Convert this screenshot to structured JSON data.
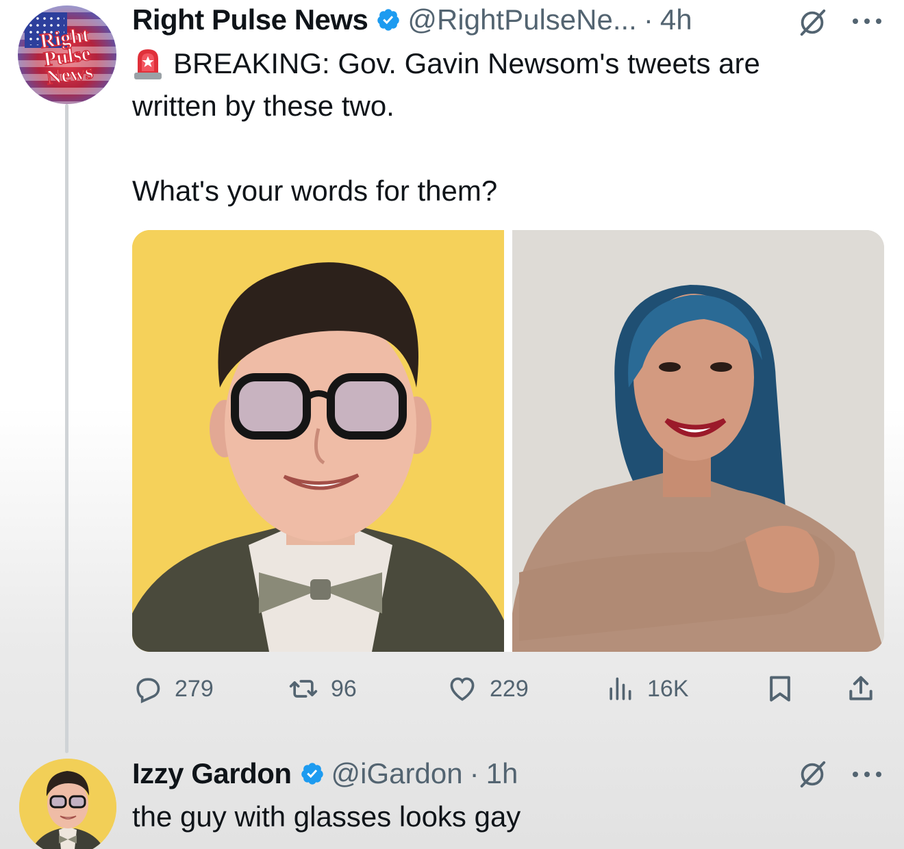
{
  "tweet": {
    "display_name": "Right Pulse News",
    "handle": "@RightPulseNe...",
    "separator": "·",
    "time": "4h",
    "avatar_text": "Right Pulse News",
    "text_line1": "BREAKING: Gov. Gavin Newsom's tweets are",
    "text_line2": "written by these two.",
    "text_line3": "What's your words for them?",
    "icons": {
      "verified": "verified-badge-icon",
      "siren": "siren-emoji-icon",
      "grok": "grok-icon",
      "more": "more-icon"
    },
    "media": [
      {
        "name": "photo-man-glasses-bowtie",
        "background": "#f5d15a"
      },
      {
        "name": "photo-woman-blue-hair",
        "background": "#e0ddd8"
      }
    ],
    "actions": {
      "replies": "279",
      "reposts": "96",
      "likes": "229",
      "views": "16K"
    }
  },
  "reply": {
    "display_name": "Izzy Gardon",
    "handle": "@iGardon",
    "separator": "·",
    "time": "1h",
    "text": "the guy with glasses looks gay"
  },
  "colors": {
    "verified_blue": "#1d9bf0",
    "secondary_text": "#536471",
    "primary_text": "#0f1419"
  }
}
